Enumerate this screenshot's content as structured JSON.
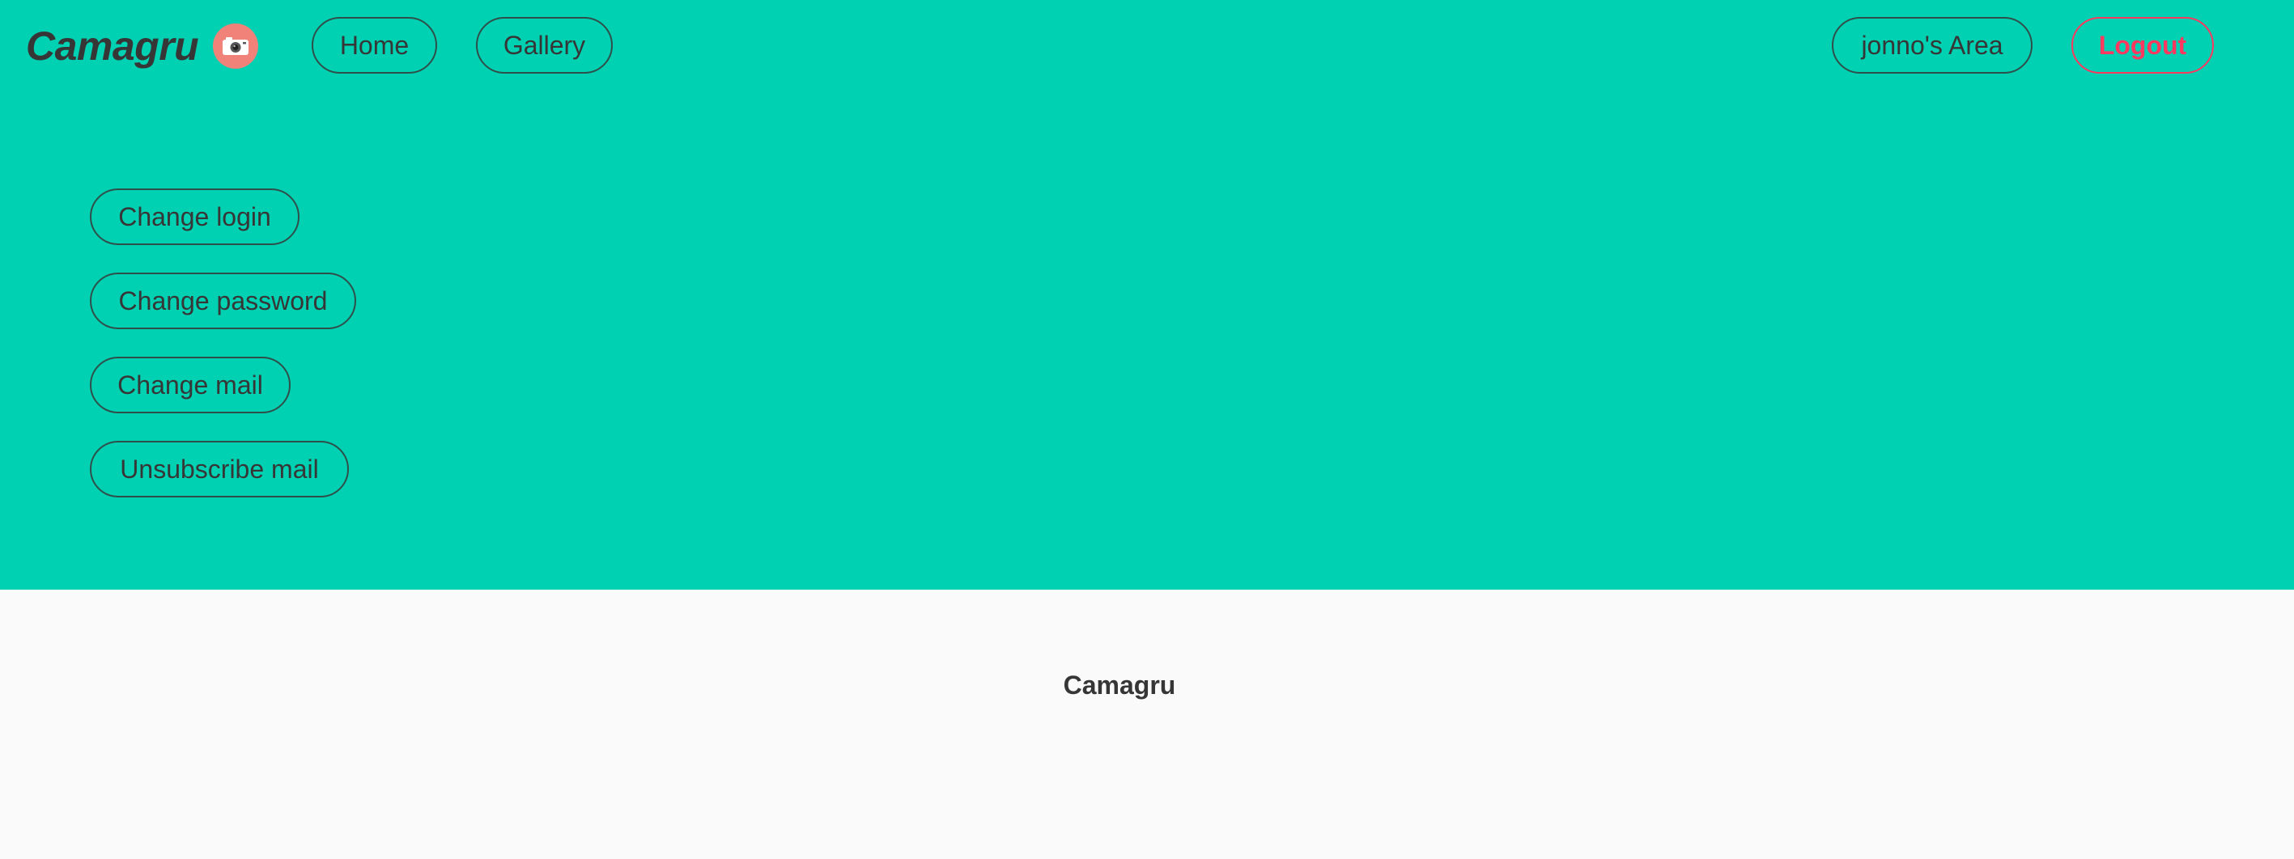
{
  "brand": {
    "title": "Camagru",
    "logo_icon": "camera-icon",
    "logo_color": "#f0827a"
  },
  "nav": {
    "home_label": "Home",
    "gallery_label": "Gallery",
    "user_area_label": "jonno's Area",
    "logout_label": "Logout"
  },
  "account_options": {
    "change_login_label": "Change login",
    "change_password_label": "Change password",
    "change_mail_label": "Change mail",
    "unsubscribe_mail_label": "Unsubscribe mail"
  },
  "footer": {
    "title": "Camagru"
  },
  "colors": {
    "primary": "#00d1b2",
    "danger": "#ff3860",
    "text": "#363636",
    "background": "#fafafa"
  }
}
